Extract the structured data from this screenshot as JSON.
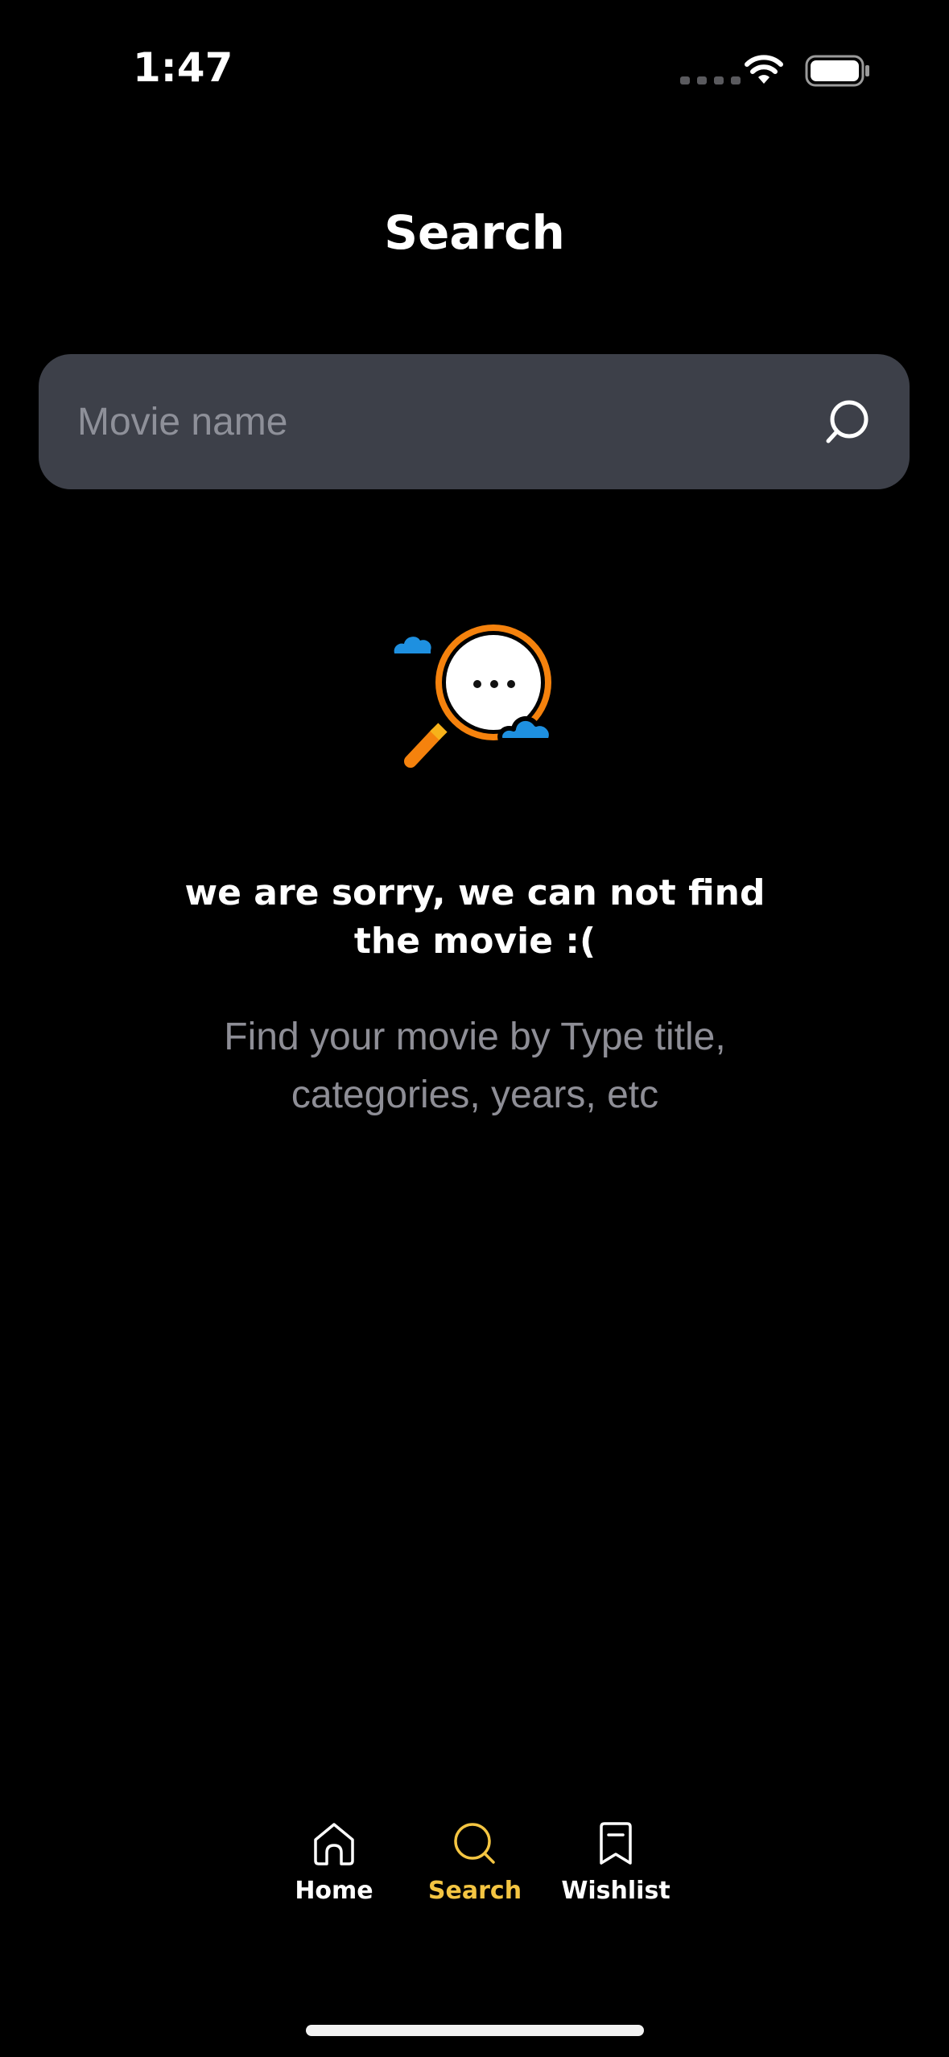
{
  "status_bar": {
    "time": "1:47",
    "icons": [
      "signal-dots-icon",
      "wifi-icon",
      "battery-icon"
    ]
  },
  "header": {
    "title": "Search"
  },
  "search": {
    "placeholder": "Movie name",
    "value": "",
    "icon": "search-icon"
  },
  "empty_state": {
    "illustration": "magnifier-cloud-illustration",
    "title_line1": "we are sorry, we can not find",
    "title_line2": "the movie :(",
    "subtitle_line1": "Find your movie by Type title,",
    "subtitle_line2": "categories, years, etc"
  },
  "tab_bar": {
    "tabs": [
      {
        "label": "Home",
        "icon": "home-icon",
        "active": false
      },
      {
        "label": "Search",
        "icon": "search-icon",
        "active": true
      },
      {
        "label": "Wishlist",
        "icon": "bookmark-icon",
        "active": false
      }
    ]
  },
  "colors": {
    "background": "#000000",
    "search_field": "#3d4049",
    "accent": "#f4c542",
    "illustration_orange": "#f5820d",
    "illustration_blue": "#1e90e0",
    "muted_text": "#8e8e96"
  }
}
